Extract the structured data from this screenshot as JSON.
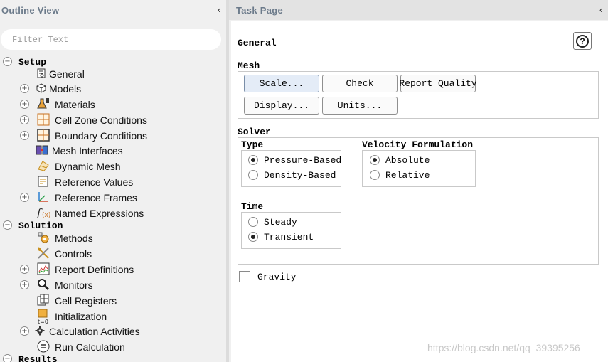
{
  "outline": {
    "title": "Outline View",
    "collapse_icon": "‹",
    "filter_placeholder": "Filter Text",
    "setup": {
      "label": "Setup",
      "items": [
        {
          "label": "General",
          "icon": "general-icon"
        },
        {
          "label": "Models",
          "icon": "models-icon"
        },
        {
          "label": "Materials",
          "icon": "materials-icon"
        },
        {
          "label": "Cell Zone Conditions",
          "icon": "cell-zone-icon"
        },
        {
          "label": "Boundary Conditions",
          "icon": "boundary-icon"
        },
        {
          "label": "Mesh Interfaces",
          "icon": "mesh-interfaces-icon"
        },
        {
          "label": "Dynamic Mesh",
          "icon": "dynamic-mesh-icon"
        },
        {
          "label": "Reference Values",
          "icon": "reference-values-icon"
        },
        {
          "label": "Reference Frames",
          "icon": "reference-frames-icon"
        },
        {
          "label": "Named Expressions",
          "icon": "named-expressions-icon"
        }
      ]
    },
    "solution": {
      "label": "Solution",
      "items": [
        {
          "label": "Methods",
          "icon": "methods-icon"
        },
        {
          "label": "Controls",
          "icon": "controls-icon"
        },
        {
          "label": "Report Definitions",
          "icon": "report-definitions-icon"
        },
        {
          "label": "Monitors",
          "icon": "monitors-icon"
        },
        {
          "label": "Cell Registers",
          "icon": "cell-registers-icon"
        },
        {
          "label": "Initialization",
          "icon": "initialization-icon"
        },
        {
          "label": "Calculation Activities",
          "icon": "calculation-activities-icon"
        },
        {
          "label": "Run Calculation",
          "icon": "run-calculation-icon"
        }
      ]
    },
    "results": {
      "label": "Results"
    }
  },
  "task": {
    "title": "Task Page",
    "collapse_icon": "‹",
    "section_title": "General",
    "help_label": "?",
    "mesh": {
      "label": "Mesh",
      "buttons": {
        "scale": "Scale...",
        "check": "Check",
        "report_quality": "Report Quality",
        "display": "Display...",
        "units": "Units..."
      }
    },
    "solver": {
      "label": "Solver",
      "type": {
        "label": "Type",
        "options": [
          "Pressure-Based",
          "Density-Based"
        ],
        "selected": "Pressure-Based"
      },
      "velocity": {
        "label": "Velocity Formulation",
        "options": [
          "Absolute",
          "Relative"
        ],
        "selected": "Absolute"
      },
      "time": {
        "label": "Time",
        "options": [
          "Steady",
          "Transient"
        ],
        "selected": "Transient"
      }
    },
    "gravity": {
      "label": "Gravity",
      "checked": false
    }
  },
  "watermark": "https://blog.csdn.net/qq_39395256",
  "colors": {
    "header_text": "#6b7a8a",
    "selected_button": "#e4ecf7",
    "panel_bg": "#f0f0f0"
  }
}
